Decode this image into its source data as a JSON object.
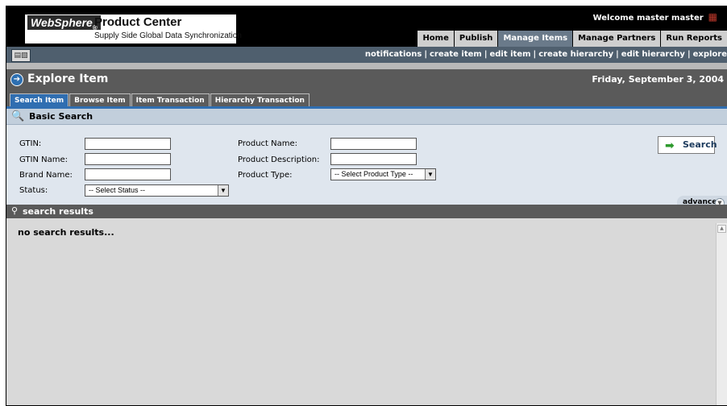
{
  "header": {
    "brand": "WebSphere",
    "brand_mark": "®",
    "product": "Product Center",
    "subtitle": "Supply Side Global Data Synchronization",
    "welcome": "Welcome  master master",
    "nav": [
      {
        "label": "Home",
        "active": false
      },
      {
        "label": "Publish",
        "active": false
      },
      {
        "label": "Manage Items",
        "active": true
      },
      {
        "label": "Manage Partners",
        "active": false
      },
      {
        "label": "Run Reports",
        "active": false
      }
    ]
  },
  "subnav": {
    "links": [
      "notifications",
      "create item",
      "edit item",
      "create hierarchy",
      "edit hierarchy",
      "explore"
    ]
  },
  "page": {
    "title": "Explore Item",
    "date": "Friday, September 3, 2004"
  },
  "tabs": [
    {
      "label": "Search Item",
      "active": true
    },
    {
      "label": "Browse Item",
      "active": false
    },
    {
      "label": "Item Transaction",
      "active": false
    },
    {
      "label": "Hierarchy Transaction",
      "active": false
    }
  ],
  "basic_search": {
    "title": "Basic Search",
    "gtin_label": "GTIN:",
    "gtin_value": "",
    "gtin_name_label": "GTIN Name:",
    "gtin_name_value": "",
    "brand_name_label": "Brand Name:",
    "brand_name_value": "",
    "status_label": "Status:",
    "status_select": "-- Select Status --",
    "product_name_label": "Product Name:",
    "product_name_value": "",
    "product_desc_label": "Product Description:",
    "product_desc_value": "",
    "product_type_label": "Product Type:",
    "product_type_select": "-- Select Product Type --",
    "search_label": "Search",
    "advanced_label": "advanced"
  },
  "results": {
    "title": "search results",
    "empty_text": "no search results..."
  }
}
